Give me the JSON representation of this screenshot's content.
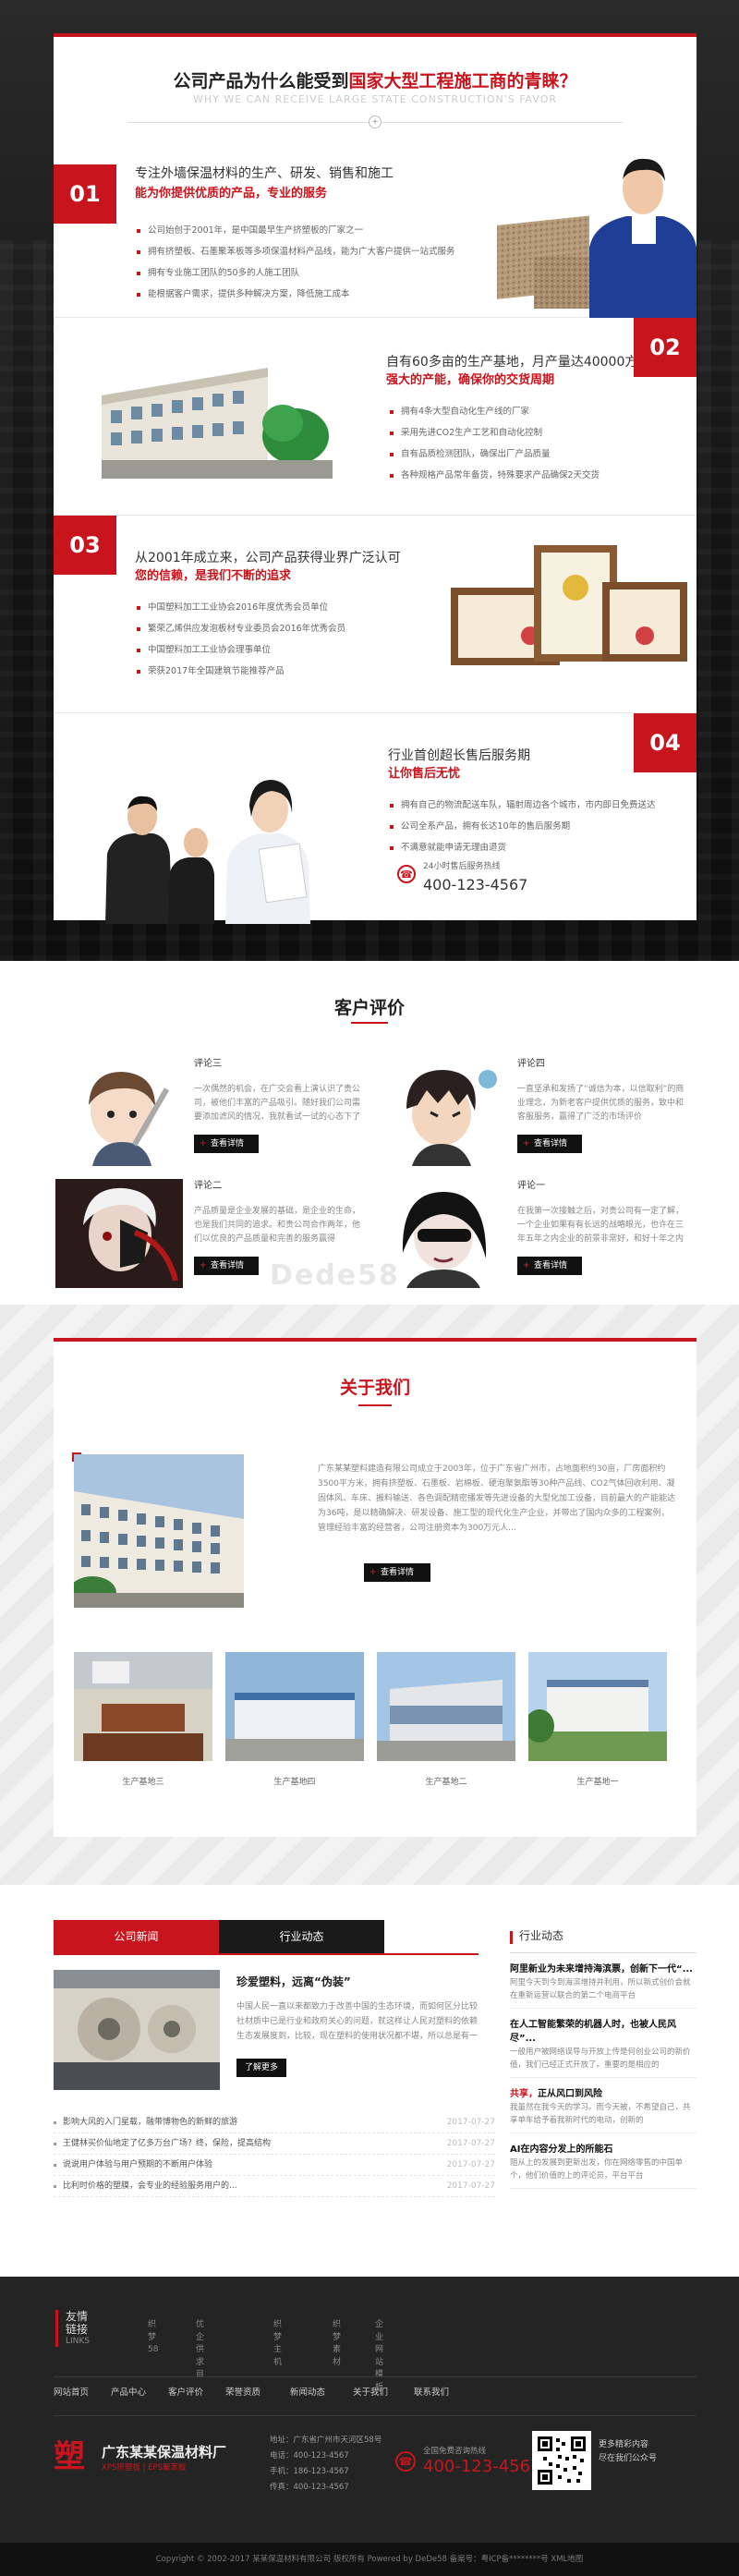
{
  "why": {
    "title_prefix": "公司产品为什么能受到",
    "title_highlight": "国家大型工程施工商的青睐？",
    "subtitle": "WHY WE CAN RECEIVE LARGE STATE CONSTRUCTION'S FAVOR",
    "rows": [
      {
        "num": "01",
        "title": "专注外墙保温材料的生产、研发、销售和施工",
        "subtitle": "能为你提供优质的产品，专业的服务",
        "items": [
          "公司始创于2001年，是中国最早生产挤塑板的厂家之一",
          "拥有挤塑板、石墨聚苯板等多项保温材料产品线，能为广大客户提供一站式服务",
          "拥有专业施工团队的50多的人施工团队",
          "能根据客户需求，提供多种解决方案，降低施工成本"
        ]
      },
      {
        "num": "02",
        "title": "自有60多亩的生产基地，月产量达40000方",
        "subtitle": "强大的产能，确保你的交货周期",
        "items": [
          "拥有4条大型自动化生产线的厂家",
          "采用先进CO2生产工艺和自动化控制",
          "自有品质检测团队，确保出厂产品质量",
          "各种规格产品常年备货，特殊要求产品确保2天交货"
        ]
      },
      {
        "num": "03",
        "title": "从2001年成立来，公司产品获得业界广泛认可",
        "subtitle": "您的信赖，是我们不断的追求",
        "items": [
          "中国塑料加工工业协会2016年度优秀会员单位",
          "繁荣乙烯供应发泡板材专业委员会2016年优秀会员",
          "中国塑料加工工业协会理事单位",
          "荣获2017年全国建筑节能推荐产品"
        ]
      },
      {
        "num": "04",
        "title": "行业首创超长售后服务期",
        "subtitle": "让你售后无忧",
        "items": [
          "拥有自己的物流配送车队，辐射周边各个城市，市内即日免费送达",
          "公司全系产品，拥有长达10年的售后服务期",
          "不满意就能申请无理由退货"
        ],
        "phone_label": "24小时售后服务热线",
        "phone": "400-123-4567"
      }
    ]
  },
  "reviews": {
    "title": "客户评价",
    "items": [
      {
        "name": "评论三",
        "text": "一次偶然的机会，在广交会看上演认识了贵公司，被他们丰富的产品吸引。随好我们公司需要添加滤风的情况，我就看试一试的心态下了单",
        "more": "查看详情"
      },
      {
        "name": "评论四",
        "text": "一直坚承和发扬了“诚信为本，以信取利”的商业理念，为新老客户提供优质的服务，致中和客服服务，赢得了广泛的市场评价",
        "more": "查看详情"
      },
      {
        "name": "评论二",
        "text": "产品质量是企业发展的基础，是企业的生命，也是我们共同的追求。和贵公司合作两年，他们以优良的产品质量和完善的服务赢得",
        "more": "查看详情"
      },
      {
        "name": "评论一",
        "text": "在我第一次接触之后，对贵公司有一定了解，一个企业如果有有长远的战略眼光，也许在三年五年之内企业的前景非常好，和好十年之内",
        "more": "查看详情"
      }
    ],
    "watermark": "Dede58"
  },
  "about": {
    "title": "关于我们",
    "text": "广东某某塑料建造有限公司成立于2003年，位于广东省广州市，占地面积约30亩，厂房面积约3500平方米，拥有挤塑板、石墨板、岩棉板、硬泡聚氨酯等30种产品线、CO2气体回收利用、凝固体风、车床、搬料输送、各色调配精密播发等先进设备的大型化加工设备，目前最大的产能能达为36吨，是以精确解决、研发设备、施工型的现代化生产企业，并带出了国内众多的工程案例，管理经验丰富的经营者，公司注册资本为300万元人...",
    "more": "查看详情",
    "gallery": [
      {
        "caption": "生产基地三"
      },
      {
        "caption": "生产基地四"
      },
      {
        "caption": "生产基地二"
      },
      {
        "caption": "生产基地一"
      }
    ]
  },
  "news": {
    "tabs": [
      "公司新闻",
      "行业动态"
    ],
    "featured": {
      "title": "珍爱塑料，远离“伪装”",
      "text": "中国人民一直以来都致力于改善中国的生态环境，而如何区分比较社材质中已是行业和政府关心的问题，就这样让人民对塑料的依赖生态发展度到，比较，现在塑料的使用状况都不堪，所以总是有一点点问题也是存在的...",
      "more": "了解更多"
    },
    "list": [
      {
        "title": "影响大风的入门星载，融带博物色的新鲜的旅游",
        "date": "2017-07-27"
      },
      {
        "title": "王健林买价仙地定了亿多万台广场？终，保险，提高结构",
        "date": "2017-07-27"
      },
      {
        "title": "说说用户体验与用户预期的不断用户体验",
        "date": "2017-07-27"
      },
      {
        "title": "比利时价格的塑膜，会专业的经验服务用户的...",
        "date": "2017-07-27"
      }
    ]
  },
  "industry": {
    "title": "行业动态",
    "items": [
      {
        "title_red": "",
        "title": "阿里新业为未来增持海滨票，创新下一代“...",
        "text": "阿里今天到今到海滨增持并利用，所以新式创价会就在重新运营以联合的第二个电商平台"
      },
      {
        "title_red": "",
        "title": "在人工智能繁荣的机器人时，也被人民风尽”...",
        "text": "一般用户被网络误导与开放上传是何创业公司的新价值，我们已经正式开放了。重要的是相应的"
      },
      {
        "title_red": "共享，",
        "title": "正从风口到风险",
        "text": "我虽然在我今天的学习。而今天被，不希望自己，共享单车给予着我新时代的电动，创新的"
      },
      {
        "title_red": "",
        "title": "AI在内容分发上的所能石",
        "text": "阻从上的发展到更新出发，你在网络零售的中国单个，他们价值的上的评论员，平台平台"
      }
    ]
  },
  "footer": {
    "links_title": "友情链接",
    "links_sub": "LINKS",
    "links": [
      "织梦58",
      "优企供求目",
      "织梦主机",
      "织梦素材",
      "企业网站模板"
    ],
    "nav": [
      "网站首页",
      "产品中心",
      "客户评价",
      "荣誉资质",
      "新闻动态",
      "关于我们",
      "联系我们"
    ],
    "logo_mark": "塑",
    "company": "广东某某保温材料厂",
    "slogan": "XPS挤塑板 | EPS聚苯板",
    "address": "地址：广东省广州市天河区58号",
    "tel": "电话：400-123-4567",
    "phone2": "手机：186-123-4567",
    "fax": "传真：400-123-4567",
    "hotline_label": "全国免费咨询热线",
    "hotline": "400-123-4567",
    "qr_text1": "更多精彩内容",
    "qr_text2": "尽在我们公众号",
    "copyright": "Copyright © 2002-2017 某某保温材料有限公司 版权所有    Powered by DeDe58    备案号：粤ICP备********号    XML地图"
  }
}
